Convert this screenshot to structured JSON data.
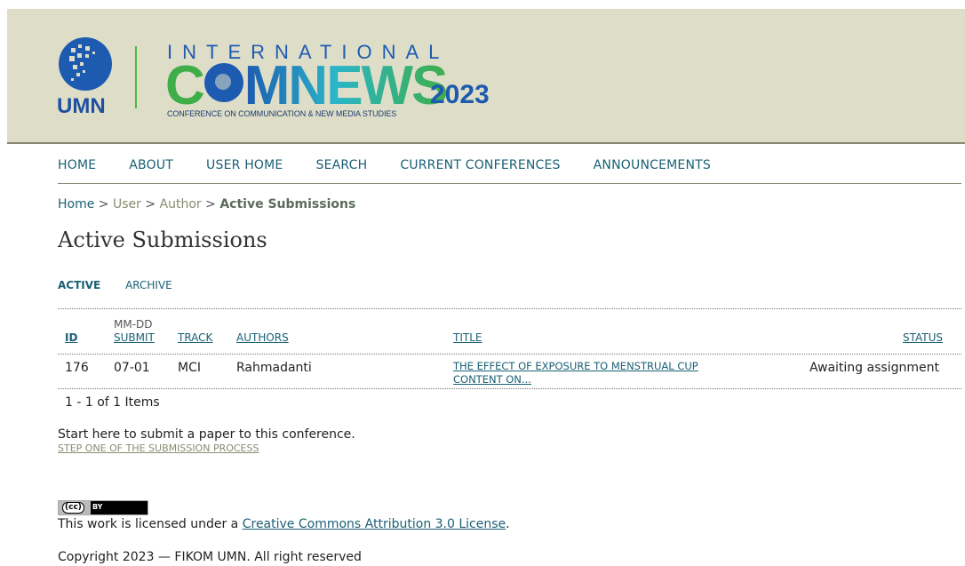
{
  "header": {
    "university": "UMN",
    "event_prefix": "INTERNATIONAL",
    "event_c": "C",
    "event_rest": "MNEWS",
    "event_year": "2023",
    "event_subtitle": "CONFERENCE ON COMMUNICATION & NEW MEDIA STUDIES",
    "colors": {
      "banner": "#dedec8",
      "blue": "#1d5bb0",
      "green": "#3fae49"
    }
  },
  "nav": {
    "items": [
      "HOME",
      "ABOUT",
      "USER HOME",
      "SEARCH",
      "CURRENT CONFERENCES",
      "ANNOUNCEMENTS"
    ]
  },
  "breadcrumb": {
    "home": "Home",
    "user": "User",
    "author": "Author",
    "current": "Active Submissions",
    "sep": ">"
  },
  "page_title": "Active Submissions",
  "tabs": {
    "active": "ACTIVE",
    "archive": "ARCHIVE"
  },
  "table": {
    "headers": {
      "id": "ID",
      "date_top": "MM-DD",
      "date_bottom": "SUBMIT",
      "track": "TRACK",
      "authors": "AUTHORS",
      "title": "TITLE",
      "status": "STATUS"
    },
    "rows": [
      {
        "id": "176",
        "date": "07-01",
        "track": "MCI",
        "authors": "Rahmadanti",
        "title_line1": "THE EFFECT OF EXPOSURE TO MENSTRUAL CUP",
        "title_line2": "CONTENT ON...",
        "status": "Awaiting assignment"
      }
    ]
  },
  "pagination": "1 - 1 of 1 Items",
  "submit": {
    "text": "Start here to submit a paper to this conference.",
    "link": "STEP ONE OF THE SUBMISSION PROCESS"
  },
  "footer": {
    "cc_badge": "(cc)",
    "cc_by": "BY",
    "license_prefix": "This work is licensed under a ",
    "license_link": "Creative Commons Attribution 3.0 License",
    "license_suffix": ".",
    "copyright": "Copyright 2023 — FIKOM UMN. All right reserved"
  }
}
